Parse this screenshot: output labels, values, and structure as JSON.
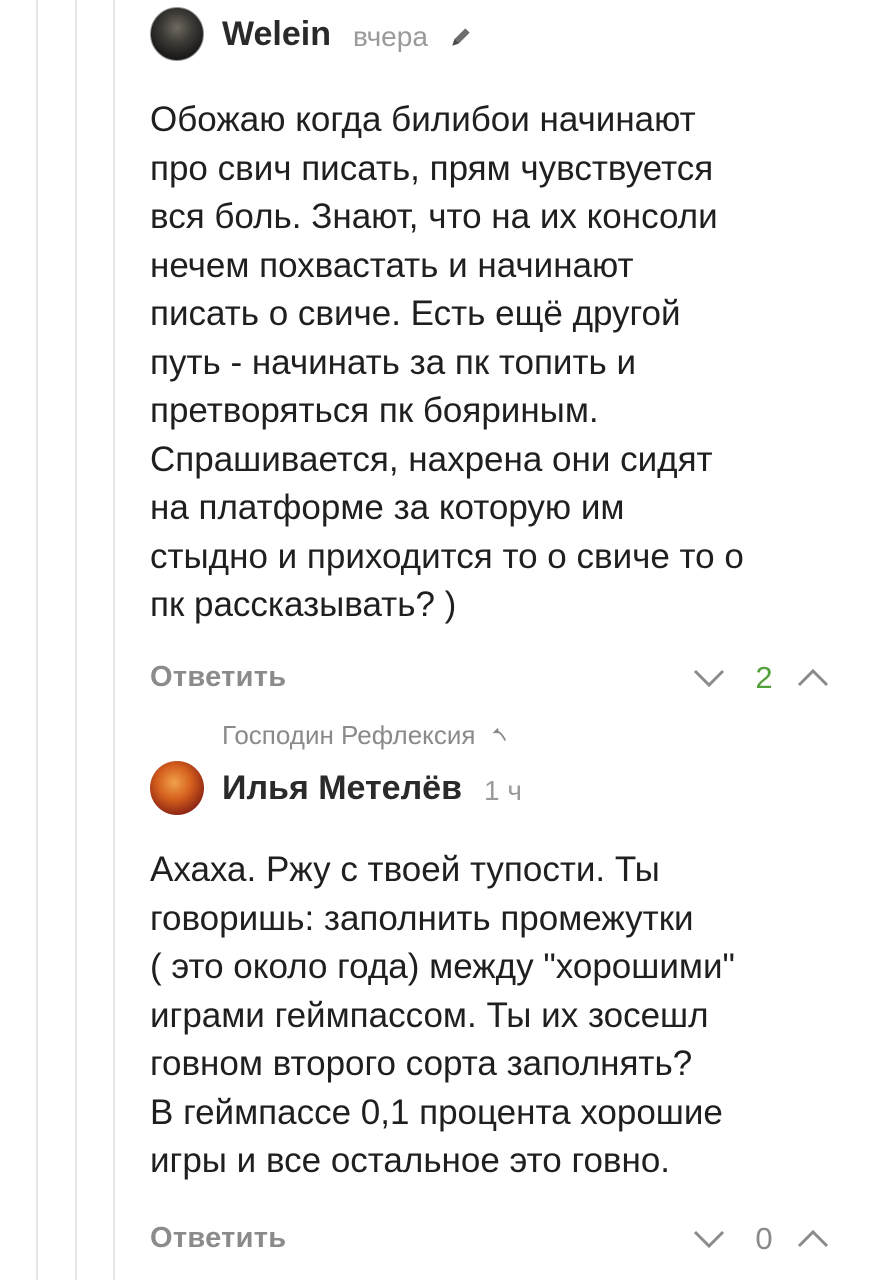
{
  "comments": [
    {
      "author": "Welein",
      "time": "вчера",
      "text": "Обожаю когда билибои начинают\nпро свич писать, прям чувствуется\nвся боль. Знают, что на их консоли\nнечем похвастать и начинают\nписать о свиче. Есть ещё другой\nпуть - начинать за пк топить и\nпретворяться пк бояриным.\nСпрашивается, нахрена они сидят\nна платформе за которую им\nстыдно и приходится то о свиче то о\nпк рассказывать? )",
      "reply_label": "Ответить",
      "score": "2"
    },
    {
      "reply_to": "Господин Рефлексия",
      "author": "Илья Метелёв",
      "time": "1 ч",
      "text": "Ахаха. Ржу с твоей тупости. Ты\nговоришь: заполнить промежутки\n( это около года) между \"хорошими\"\nиграми геймпассом. Ты их зосешл\nговном второго сорта заполнять?\nВ геймпассе 0,1 процента хорошие\nигры и все остальное это говно.",
      "reply_label": "Ответить",
      "score": "0"
    }
  ],
  "colors": {
    "positive_score": "#54a03a",
    "muted": "#8b8b8b",
    "thread_line": "#e6e6e6"
  }
}
